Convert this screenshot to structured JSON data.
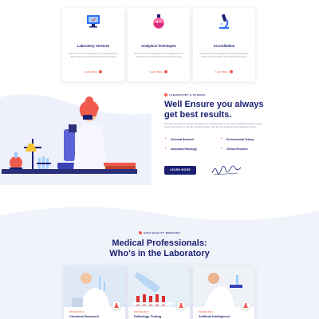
{
  "services": [
    {
      "title": "Laboratory Services",
      "icon": "monitor-icon",
      "description": "We use the true potential of your data with our data science experts and machine learning",
      "link": "Learn More"
    },
    {
      "title": "Analytical Techniques",
      "icon": "flask-icon",
      "description": "We use the true potential of your data with our data science experts and machine learning",
      "link": "Learn More"
    },
    {
      "title": "Accreditation",
      "icon": "microscope-icon",
      "description": "We use the true potential of your data with our data science experts and machine learning",
      "link": "Learn More"
    }
  ],
  "hero": {
    "tag": "LABORATORY & SCIENCE",
    "title": "Well Ensure you always get best results.",
    "description": "We have developed reliable strategies for testing liquids in all of the medical research ranges using innovations in the lab and automation. We are an accredited and approved team.",
    "checks": [
      "Chemical Research",
      "Environmental Testing",
      "Automated Pathology",
      "Clinical Research"
    ],
    "button": "LEARN MORE"
  },
  "professionals": {
    "tag": "HIGH QUALITY SERVICES",
    "title_line1": "Medical Professionals:",
    "title_line2": "Who's in the Laboratory",
    "cards": [
      {
        "category": "PATHOLOGY",
        "name": "Chemical Research",
        "icon": "flask-icon"
      },
      {
        "category": "PATHOLOGY",
        "name": "Pathology Testing",
        "icon": "flask-icon"
      },
      {
        "category": "PATHOLOGY",
        "name": "Artificial Intelligence",
        "icon": "flask-icon"
      }
    ]
  },
  "colors": {
    "navy": "#1a1f71",
    "accent": "#ef5b4c",
    "muted": "#8a8ea8",
    "wave": "#f1f3fb"
  }
}
